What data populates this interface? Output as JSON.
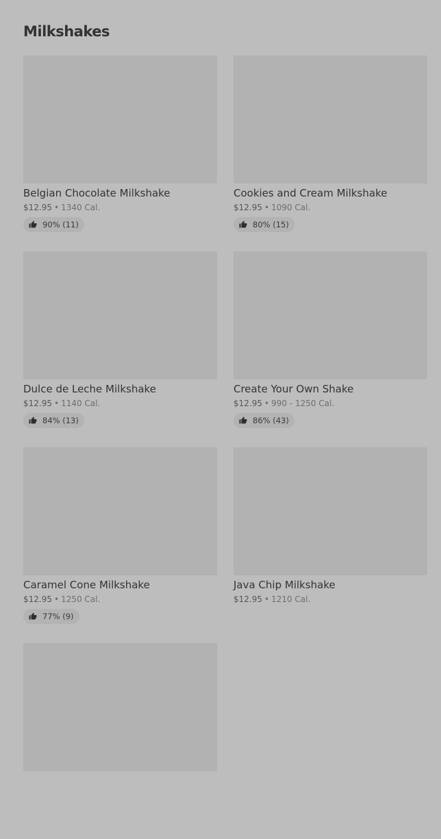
{
  "section": {
    "title": "Milkshakes"
  },
  "items": [
    {
      "name": "Belgian Chocolate Milkshake",
      "price": "$12.95",
      "separator": "•",
      "calories": "1340 Cal.",
      "rating": "90% (11)"
    },
    {
      "name": "Cookies and Cream Milkshake",
      "price": "$12.95",
      "separator": "•",
      "calories": "1090 Cal.",
      "rating": "80% (15)"
    },
    {
      "name": "Dulce de Leche Milkshake",
      "price": "$12.95",
      "separator": "•",
      "calories": "1140 Cal.",
      "rating": "84% (13)"
    },
    {
      "name": "Create Your Own Shake",
      "price": "$12.95",
      "separator": "•",
      "calories": "990 - 1250 Cal.",
      "rating": "86% (43)"
    },
    {
      "name": "Caramel Cone Milkshake",
      "price": "$12.95",
      "separator": "•",
      "calories": "1250 Cal.",
      "rating": "77% (9)"
    },
    {
      "name": "Java Chip Milkshake",
      "price": "$12.95",
      "separator": "•",
      "calories": "1210 Cal.",
      "rating": null
    },
    {
      "name": null,
      "price": null,
      "separator": null,
      "calories": null,
      "rating": null
    }
  ]
}
